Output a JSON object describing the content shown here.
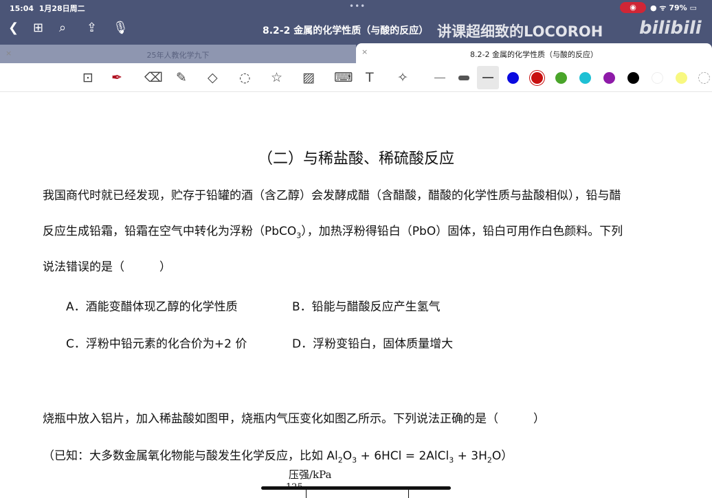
{
  "status": {
    "time": "15:04",
    "date": "1月28日周二",
    "battery": "79%"
  },
  "nav": {
    "title": "8.2-2 金属的化学性质（与酸的反应）",
    "watermark": "讲课超细致的LOCOROH",
    "logo": "bilibili"
  },
  "tabs": [
    {
      "label": "25年人教化学九下",
      "active": false
    },
    {
      "label": "8.2-2 金属的化学性质（与酸的反应）",
      "active": true
    }
  ],
  "colors": {
    "swatches": [
      "#0a0ae0",
      "#c81010",
      "#4aa52a",
      "#1ec0d4",
      "#8e1aa8",
      "#000000",
      "#ffffff",
      "#f8f880"
    ]
  },
  "doc": {
    "heading": "（二）与稀盐酸、稀硫酸反应",
    "q1_line1": "我国商代时就已经发现，贮存于铅罐的酒（含乙醇）会发酵成醋（含醋酸，醋酸的化学性质与盐酸相似），铅与醋",
    "q1_line2a": "反应生成铅霜，铅霜在空气中转化为浮粉（PbCO",
    "q1_line2sub": "3",
    "q1_line2b": "），加热浮粉得铅白（PbO）固体，铅白可用作白色颜料。下列",
    "q1_line3": "说法错误的是（　　　）",
    "options": [
      "A．酒能变醋体现乙醇的化学性质",
      "B．铅能与醋酸反应产生氢气",
      "C．浮粉中铅元素的化合价为+2 价",
      "D．浮粉变铅白，固体质量增大"
    ],
    "q2_line1": "烧瓶中放入铝片，加入稀盐酸如图甲，烧瓶内气压变化如图乙所示。下列说法正确的是（　　　）",
    "q2_line2": [
      "（已知：大多数金属氧化物能与酸发生化学反应，比如 Al",
      "2",
      "O",
      "3",
      " + 6HCl = 2AlCl",
      "3",
      " + 3H",
      "2",
      "O）"
    ],
    "chart_ylabel": "压强/kPa",
    "chart_tick": "125"
  }
}
